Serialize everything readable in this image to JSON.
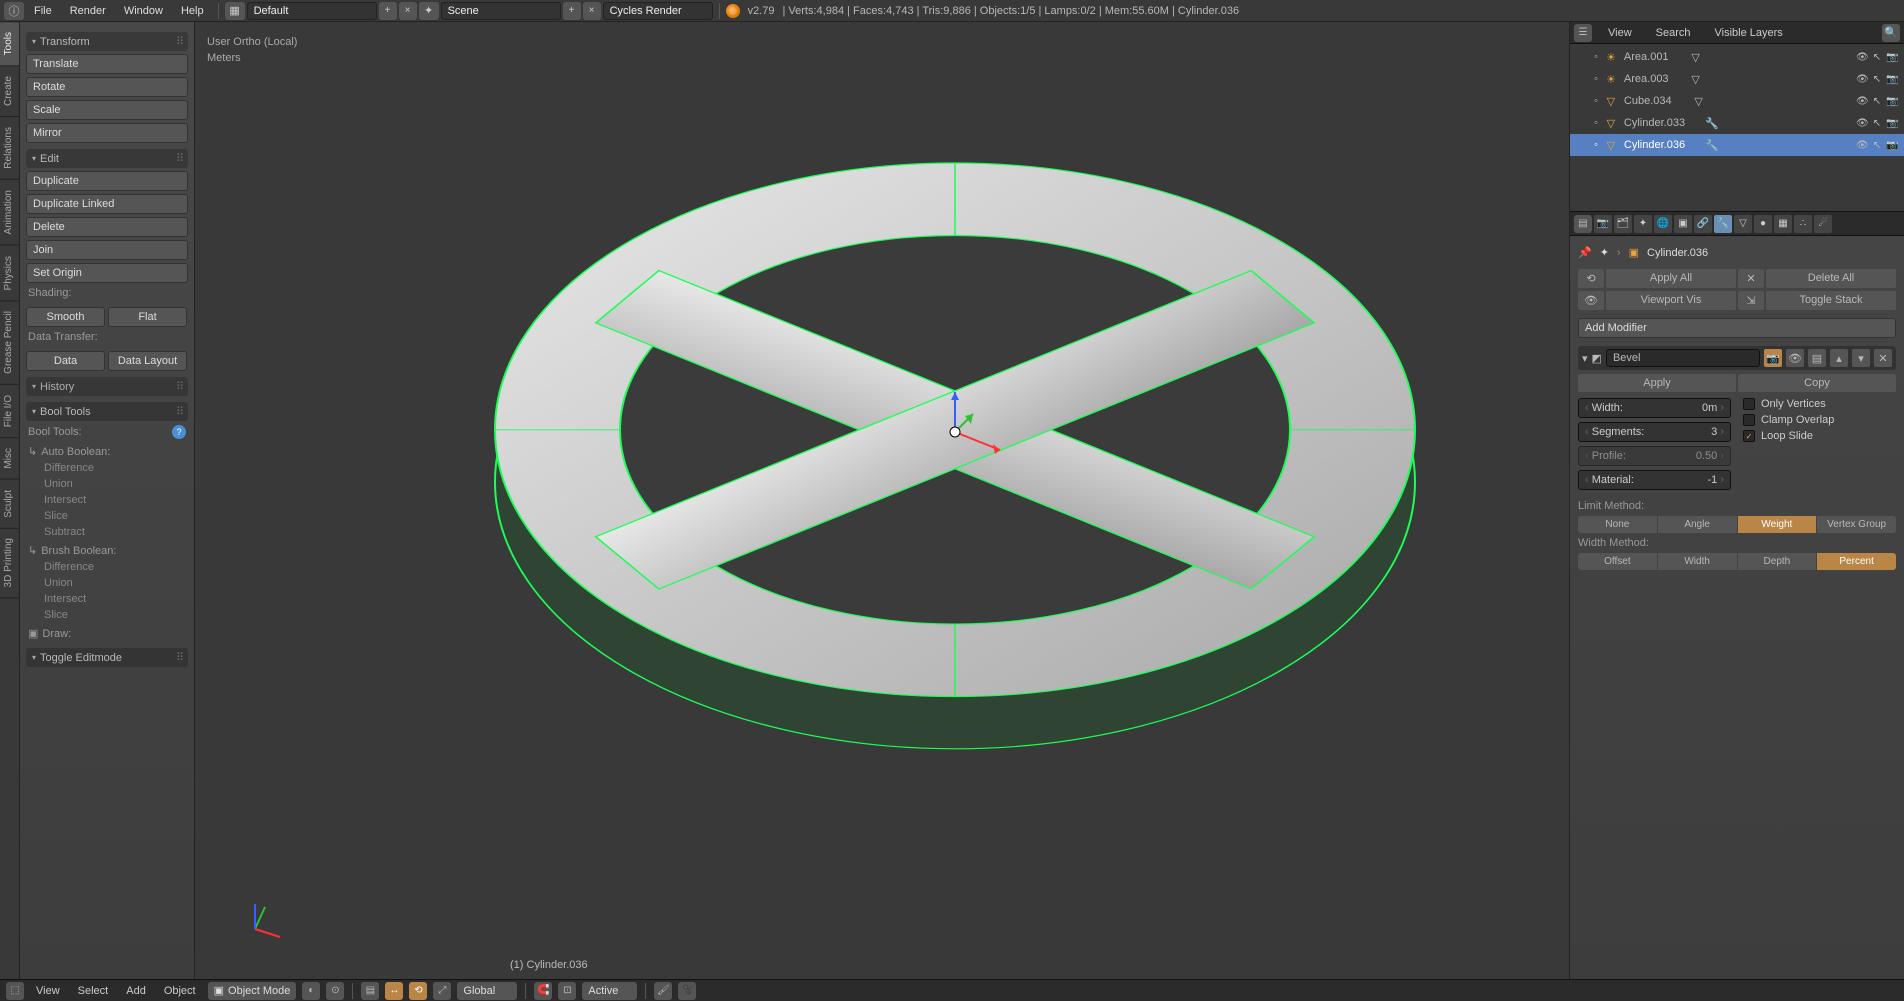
{
  "top": {
    "menus": [
      "File",
      "Render",
      "Window",
      "Help"
    ],
    "layout_field": "Default",
    "scene_field": "Scene",
    "engine": "Cycles Render",
    "version": "v2.79",
    "stats": "Verts:4,984 | Faces:4,743 | Tris:9,886 | Objects:1/5 | Lamps:0/2 | Mem:55.60M | Cylinder.036"
  },
  "left_vtabs": [
    "Tools",
    "Create",
    "Relations",
    "Animation",
    "Physics",
    "Grease Pencil",
    "File I/O",
    "Misc",
    "Sculpt",
    "3D Printing"
  ],
  "tools": {
    "transform_hdr": "Transform",
    "transform": [
      "Translate",
      "Rotate",
      "Scale",
      "Mirror"
    ],
    "edit_hdr": "Edit",
    "edit": [
      "Duplicate",
      "Duplicate Linked",
      "Delete",
      "Join",
      "Set Origin"
    ],
    "shading_label": "Shading:",
    "shading": [
      "Smooth",
      "Flat"
    ],
    "data_transfer_label": "Data Transfer:",
    "data_transfer": [
      "Data",
      "Data Layout"
    ],
    "history_hdr": "History",
    "bool_hdr": "Bool Tools",
    "bool_label": "Bool Tools:",
    "auto_label": "Auto Boolean:",
    "auto_ops": [
      "Difference",
      "Union",
      "Intersect",
      "Slice",
      "Subtract"
    ],
    "brush_label": "Brush Boolean:",
    "brush_ops": [
      "Difference",
      "Union",
      "Intersect",
      "Slice"
    ],
    "draw_label": "Draw:",
    "toggle_edit": "Toggle Editmode"
  },
  "viewport": {
    "overlay1": "User Ortho (Local)",
    "overlay2": "Meters",
    "selected": "(1) Cylinder.036"
  },
  "outliner": {
    "tabs": [
      "View",
      "Search",
      "Visible Layers"
    ],
    "items": [
      {
        "name": "Area.001",
        "icon": "lamp",
        "mod": "mesh"
      },
      {
        "name": "Area.003",
        "icon": "lamp",
        "mod": "mesh"
      },
      {
        "name": "Cube.034",
        "icon": "mesh",
        "mod": "mesh"
      },
      {
        "name": "Cylinder.033",
        "icon": "mesh",
        "mod": "wrench"
      },
      {
        "name": "Cylinder.036",
        "icon": "mesh",
        "mod": "wrench",
        "active": true
      }
    ]
  },
  "props": {
    "breadcrumb": "Cylinder.036",
    "apply_all": "Apply All",
    "delete_all": "Delete All",
    "viewport_vis": "Viewport Vis",
    "toggle_stack": "Toggle Stack",
    "add_modifier": "Add Modifier",
    "mod_name": "Bevel",
    "apply": "Apply",
    "copy": "Copy",
    "width_label": "Width:",
    "width_value": "0m",
    "segments_label": "Segments:",
    "segments_value": "3",
    "profile_label": "Profile:",
    "profile_value": "0.50",
    "material_label": "Material:",
    "material_value": "-1",
    "only_verts": "Only Vertices",
    "clamp_overlap": "Clamp Overlap",
    "loop_slide": "Loop Slide",
    "limit_label": "Limit Method:",
    "limit": [
      "None",
      "Angle",
      "Weight",
      "Vertex Group"
    ],
    "limit_active": "Weight",
    "widthm_label": "Width Method:",
    "widthm": [
      "Offset",
      "Width",
      "Depth",
      "Percent"
    ],
    "widthm_active": "Percent"
  },
  "bottom": {
    "menus": [
      "View",
      "Select",
      "Add",
      "Object"
    ],
    "mode": "Object Mode",
    "orient": "Global",
    "snap_target": "Active"
  }
}
